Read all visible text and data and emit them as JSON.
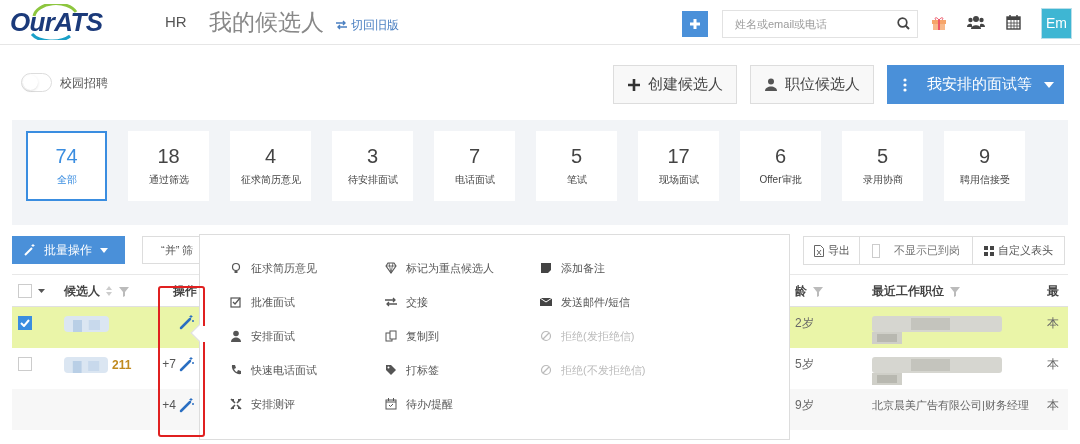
{
  "header": {
    "logo": "OurATS",
    "role": "HR",
    "title": "我的候选人",
    "switch_link": "切回旧版",
    "search": {
      "placeholder": "姓名或email或电话"
    },
    "avatar": "Em"
  },
  "campus_toggle": {
    "label": "校园招聘",
    "on": false
  },
  "actions": [
    {
      "label": "创建候选人",
      "kind": "plus"
    },
    {
      "label": "职位候选人",
      "kind": "person"
    },
    {
      "label": "我安排的面试等",
      "kind": "primary"
    }
  ],
  "stages": [
    {
      "count": "74",
      "label": "全部",
      "selected": true
    },
    {
      "count": "18",
      "label": "通过筛选",
      "selected": false
    },
    {
      "count": "4",
      "label": "征求简历意见",
      "selected": false
    },
    {
      "count": "3",
      "label": "待安排面试",
      "selected": false
    },
    {
      "count": "7",
      "label": "电话面试",
      "selected": false
    },
    {
      "count": "5",
      "label": "笔试",
      "selected": false
    },
    {
      "count": "17",
      "label": "现场面试",
      "selected": false
    },
    {
      "count": "6",
      "label": "Offer审批",
      "selected": false
    },
    {
      "count": "5",
      "label": "录用协商",
      "selected": false
    },
    {
      "count": "9",
      "label": "聘用信接受",
      "selected": false
    }
  ],
  "toolbar": {
    "batch": "批量操作",
    "filter": "“并” 筛",
    "export": "导出",
    "hide_onboard": {
      "label": "不显示已到岗",
      "checked": false
    },
    "custom_header": "自定义表头"
  },
  "table": {
    "select_all": {
      "checked": false
    },
    "columns": [
      "候选人",
      "操作",
      "龄",
      "最近工作职位",
      "最"
    ],
    "rows": [
      {
        "selected": true,
        "tag": "",
        "extra": "",
        "age": "2岁",
        "job": "",
        "column_5": "本"
      },
      {
        "selected": false,
        "tag": "211",
        "extra": "+7",
        "age": "5岁",
        "job": "",
        "column_5": "本"
      },
      {
        "selected": false,
        "tag": "",
        "extra": "+4",
        "age": "9岁",
        "job": "北京晨美广告有限公司|财务经理",
        "column_5": "本"
      }
    ]
  },
  "action_menu": {
    "columns": [
      {
        "items": [
          {
            "label": "征求简历意见",
            "disabled": false
          },
          {
            "label": "批准面试",
            "disabled": false
          },
          {
            "label": "安排面试",
            "disabled": false
          },
          {
            "label": "快速电话面试",
            "disabled": false
          },
          {
            "label": "安排测评",
            "disabled": false
          }
        ]
      },
      {
        "items": [
          {
            "label": "标记为重点候选人",
            "disabled": false
          },
          {
            "label": "交接",
            "disabled": false
          },
          {
            "label": "复制到",
            "disabled": false
          },
          {
            "label": "打标签",
            "disabled": false
          },
          {
            "label": "待办/提醒",
            "disabled": false
          }
        ]
      },
      {
        "items": [
          {
            "label": "添加备注",
            "disabled": false
          },
          {
            "label": "发送邮件/短信",
            "disabled": false
          },
          {
            "label": "拒绝(发拒绝信)",
            "disabled": true
          },
          {
            "label": "拒绝(不发拒绝信)",
            "disabled": true
          }
        ]
      }
    ]
  }
}
